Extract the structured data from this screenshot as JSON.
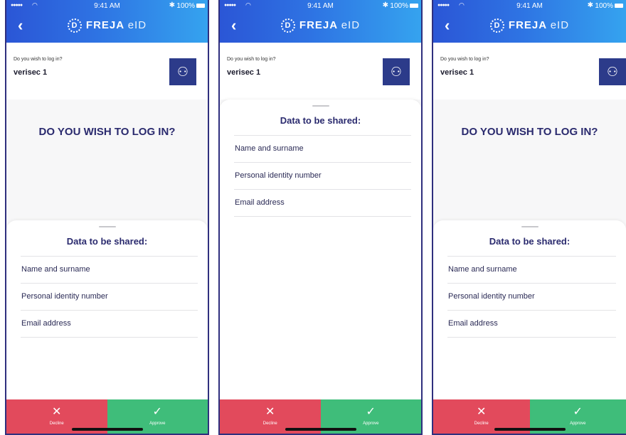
{
  "status_bar": {
    "signal": "●●●●●",
    "wifi_icon": "wifi-icon",
    "time": "9:41 AM",
    "bluetooth_icon": "bluetooth-icon",
    "battery": "100%"
  },
  "header": {
    "back_icon": "chevron-left-icon",
    "brand_mark": "D",
    "brand_name": "FREJA",
    "brand_suffix": "eID"
  },
  "login_card": {
    "question": "Do you wish to log in?",
    "service": "verisec 1",
    "logo_icon": "verisec-logo-icon"
  },
  "main_heading": "DO YOU WISH TO LOG IN?",
  "share_sheet": {
    "title": "Data to be shared:",
    "items": [
      "Name and surname",
      "Personal identity number",
      "Email address"
    ]
  },
  "actions": {
    "decline_label": "Decline",
    "approve_label": "Approve",
    "decline_symbol": "✕",
    "approve_symbol": "✓"
  },
  "colors": {
    "header_gradient_start": "#2b56d6",
    "header_gradient_end": "#35a3ef",
    "heading": "#2a2a6e",
    "decline": "#e24a5c",
    "approve": "#3fbd7a",
    "logo_bg": "#2c3b8a"
  }
}
